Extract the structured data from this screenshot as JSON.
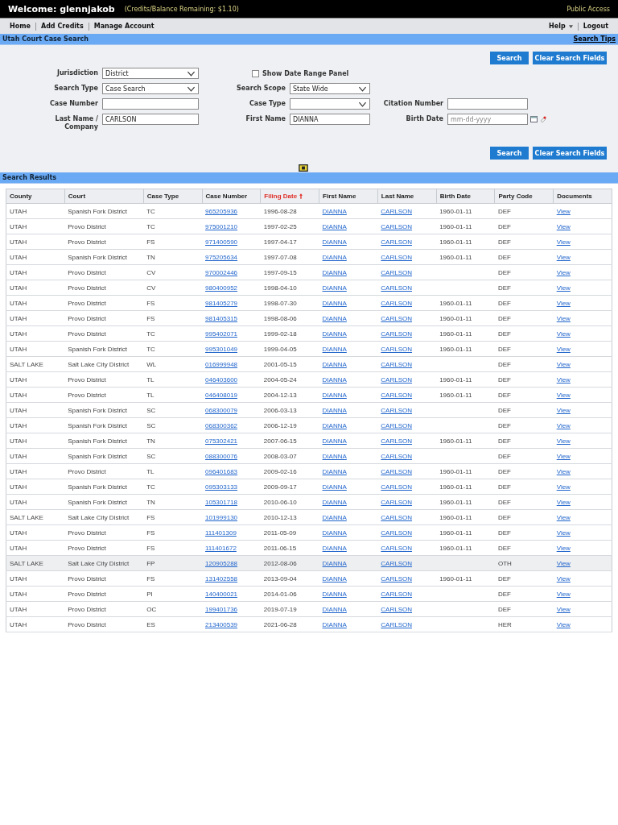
{
  "header": {
    "welcome": "Welcome: glennjakob",
    "credits": "(Credits/Balance Remaining: $1.10)",
    "access": "Public Access"
  },
  "nav": {
    "left": [
      "Home",
      "Add Credits",
      "Manage Account"
    ],
    "help": "Help",
    "logout": "Logout"
  },
  "search_panel": {
    "title": "Utah Court Case Search",
    "tips": "Search Tips",
    "top_buttons": {
      "search": "Search",
      "clear": "Clear Search Fields"
    },
    "bottom_buttons": {
      "search": "Search",
      "clear": "Clear Search Fields"
    },
    "jurisdiction": {
      "label": "Jurisdiction",
      "value": "District"
    },
    "date_range": {
      "label": "Show Date Range Panel",
      "checked": false
    },
    "search_type": {
      "label": "Search Type",
      "value": "Case Search"
    },
    "search_scope": {
      "label": "Search Scope",
      "value": "State Wide"
    },
    "case_number": {
      "label": "Case Number"
    },
    "case_type": {
      "label": "Case Type"
    },
    "citation_number": {
      "label": "Citation Number"
    },
    "last_name": {
      "label": "Last Name / Company",
      "value": "CARLSON"
    },
    "first_name": {
      "label": "First Name",
      "value": "DIANNA"
    },
    "birth_date": {
      "label": "Birth Date",
      "placeholder": "mm-dd-yyyy"
    }
  },
  "results": {
    "title": "Search Results",
    "columns": [
      {
        "label": "County",
        "sorted": false
      },
      {
        "label": "Court",
        "sorted": false
      },
      {
        "label": "Case Type",
        "sorted": false
      },
      {
        "label": "Case Number",
        "sorted": false
      },
      {
        "label": "Filing Date",
        "sorted": true
      },
      {
        "label": "First Name",
        "sorted": false
      },
      {
        "label": "Last Name",
        "sorted": false
      },
      {
        "label": "Birth Date",
        "sorted": false
      },
      {
        "label": "Party Code",
        "sorted": false
      },
      {
        "label": "Documents",
        "sorted": false
      }
    ],
    "rows": [
      {
        "county": "UTAH",
        "court": "Spanish Fork District",
        "case_type": "TC",
        "case_number": "965205936",
        "filing_date": "1996-08-28",
        "first_name": "DIANNA",
        "last_name": "CARLSON",
        "birth_date": "1960-01-11",
        "party_code": "DEF",
        "documents": "View",
        "selected": false
      },
      {
        "county": "UTAH",
        "court": "Provo District",
        "case_type": "TC",
        "case_number": "975001210",
        "filing_date": "1997-02-25",
        "first_name": "DIANNA",
        "last_name": "CARLSON",
        "birth_date": "1960-01-11",
        "party_code": "DEF",
        "documents": "View",
        "selected": false
      },
      {
        "county": "UTAH",
        "court": "Provo District",
        "case_type": "FS",
        "case_number": "971400590",
        "filing_date": "1997-04-17",
        "first_name": "DIANNA",
        "last_name": "CARLSON",
        "birth_date": "1960-01-11",
        "party_code": "DEF",
        "documents": "View",
        "selected": false
      },
      {
        "county": "UTAH",
        "court": "Spanish Fork District",
        "case_type": "TN",
        "case_number": "975205634",
        "filing_date": "1997-07-08",
        "first_name": "DIANNA",
        "last_name": "CARLSON",
        "birth_date": "1960-01-11",
        "party_code": "DEF",
        "documents": "View",
        "selected": false
      },
      {
        "county": "UTAH",
        "court": "Provo District",
        "case_type": "CV",
        "case_number": "970002446",
        "filing_date": "1997-09-15",
        "first_name": "DIANNA",
        "last_name": "CARLSON",
        "party_code": "DEF",
        "documents": "View",
        "selected": false
      },
      {
        "county": "UTAH",
        "court": "Provo District",
        "case_type": "CV",
        "case_number": "980400952",
        "filing_date": "1998-04-10",
        "first_name": "DIANNA",
        "last_name": "CARLSON",
        "party_code": "DEF",
        "documents": "View",
        "selected": false
      },
      {
        "county": "UTAH",
        "court": "Provo District",
        "case_type": "FS",
        "case_number": "981405279",
        "filing_date": "1998-07-30",
        "first_name": "DIANNA",
        "last_name": "CARLSON",
        "birth_date": "1960-01-11",
        "party_code": "DEF",
        "documents": "View",
        "selected": false
      },
      {
        "county": "UTAH",
        "court": "Provo District",
        "case_type": "FS",
        "case_number": "981405315",
        "filing_date": "1998-08-06",
        "first_name": "DIANNA",
        "last_name": "CARLSON",
        "birth_date": "1960-01-11",
        "party_code": "DEF",
        "documents": "View",
        "selected": false
      },
      {
        "county": "UTAH",
        "court": "Provo District",
        "case_type": "TC",
        "case_number": "995402071",
        "filing_date": "1999-02-18",
        "first_name": "DIANNA",
        "last_name": "CARLSON",
        "birth_date": "1960-01-11",
        "party_code": "DEF",
        "documents": "View",
        "selected": false
      },
      {
        "county": "UTAH",
        "court": "Spanish Fork District",
        "case_type": "TC",
        "case_number": "995301049",
        "filing_date": "1999-04-05",
        "first_name": "DIANNA",
        "last_name": "CARLSON",
        "birth_date": "1960-01-11",
        "party_code": "DEF",
        "documents": "View",
        "selected": false
      },
      {
        "county": "SALT LAKE",
        "court": "Salt Lake City District",
        "case_type": "WL",
        "case_number": "016999948",
        "filing_date": "2001-05-15",
        "first_name": "DIANNA",
        "last_name": "CARLSON",
        "party_code": "DEF",
        "documents": "View",
        "selected": false
      },
      {
        "county": "UTAH",
        "court": "Provo District",
        "case_type": "TL",
        "case_number": "046403600",
        "filing_date": "2004-05-24",
        "first_name": "DIANNA",
        "last_name": "CARLSON",
        "birth_date": "1960-01-11",
        "party_code": "DEF",
        "documents": "View",
        "selected": false
      },
      {
        "county": "UTAH",
        "court": "Provo District",
        "case_type": "TL",
        "case_number": "046408019",
        "filing_date": "2004-12-13",
        "first_name": "DIANNA",
        "last_name": "CARLSON",
        "birth_date": "1960-01-11",
        "party_code": "DEF",
        "documents": "View",
        "selected": false
      },
      {
        "county": "UTAH",
        "court": "Spanish Fork District",
        "case_type": "SC",
        "case_number": "068300079",
        "filing_date": "2006-03-13",
        "first_name": "DIANNA",
        "last_name": "CARLSON",
        "party_code": "DEF",
        "documents": "View",
        "selected": false
      },
      {
        "county": "UTAH",
        "court": "Spanish Fork District",
        "case_type": "SC",
        "case_number": "068300362",
        "filing_date": "2006-12-19",
        "first_name": "DIANNA",
        "last_name": "CARLSON",
        "party_code": "DEF",
        "documents": "View",
        "selected": false
      },
      {
        "county": "UTAH",
        "court": "Spanish Fork District",
        "case_type": "TN",
        "case_number": "075302421",
        "filing_date": "2007-06-15",
        "first_name": "DIANNA",
        "last_name": "CARLSON",
        "birth_date": "1960-01-11",
        "party_code": "DEF",
        "documents": "View",
        "selected": false
      },
      {
        "county": "UTAH",
        "court": "Spanish Fork District",
        "case_type": "SC",
        "case_number": "088300076",
        "filing_date": "2008-03-07",
        "first_name": "DIANNA",
        "last_name": "CARLSON",
        "party_code": "DEF",
        "documents": "View",
        "selected": false
      },
      {
        "county": "UTAH",
        "court": "Provo District",
        "case_type": "TL",
        "case_number": "096401683",
        "filing_date": "2009-02-16",
        "first_name": "DIANNA",
        "last_name": "CARLSON",
        "birth_date": "1960-01-11",
        "party_code": "DEF",
        "documents": "View",
        "selected": false
      },
      {
        "county": "UTAH",
        "court": "Spanish Fork District",
        "case_type": "TC",
        "case_number": "095303133",
        "filing_date": "2009-09-17",
        "first_name": "DIANNA",
        "last_name": "CARLSON",
        "birth_date": "1960-01-11",
        "party_code": "DEF",
        "documents": "View",
        "selected": false
      },
      {
        "county": "UTAH",
        "court": "Spanish Fork District",
        "case_type": "TN",
        "case_number": "105301718",
        "filing_date": "2010-06-10",
        "first_name": "DIANNA",
        "last_name": "CARLSON",
        "birth_date": "1960-01-11",
        "party_code": "DEF",
        "documents": "View",
        "selected": false
      },
      {
        "county": "SALT LAKE",
        "court": "Salt Lake City District",
        "case_type": "FS",
        "case_number": "101999130",
        "filing_date": "2010-12-13",
        "first_name": "DIANNA",
        "last_name": "CARLSON",
        "birth_date": "1960-01-11",
        "party_code": "DEF",
        "documents": "View",
        "selected": false
      },
      {
        "county": "UTAH",
        "court": "Provo District",
        "case_type": "FS",
        "case_number": "111401309",
        "filing_date": "2011-05-09",
        "first_name": "DIANNA",
        "last_name": "CARLSON",
        "birth_date": "1960-01-11",
        "party_code": "DEF",
        "documents": "View",
        "selected": false
      },
      {
        "county": "UTAH",
        "court": "Provo District",
        "case_type": "FS",
        "case_number": "111401672",
        "filing_date": "2011-06-15",
        "first_name": "DIANNA",
        "last_name": "CARLSON",
        "birth_date": "1960-01-11",
        "party_code": "DEF",
        "documents": "View",
        "selected": false
      },
      {
        "county": "SALT LAKE",
        "court": "Salt Lake City District",
        "case_type": "FP",
        "case_number": "120905288",
        "filing_date": "2012-08-06",
        "first_name": "DIANNA",
        "last_name": "CARLSON",
        "party_code": "OTH",
        "documents": "View",
        "selected": true
      },
      {
        "county": "UTAH",
        "court": "Provo District",
        "case_type": "FS",
        "case_number": "131402558",
        "filing_date": "2013-09-04",
        "first_name": "DIANNA",
        "last_name": "CARLSON",
        "birth_date": "1960-01-11",
        "party_code": "DEF",
        "documents": "View",
        "selected": false
      },
      {
        "county": "UTAH",
        "court": "Provo District",
        "case_type": "PI",
        "case_number": "140400021",
        "filing_date": "2014-01-06",
        "first_name": "DIANNA",
        "last_name": "CARLSON",
        "party_code": "DEF",
        "documents": "View",
        "selected": false
      },
      {
        "county": "UTAH",
        "court": "Provo District",
        "case_type": "OC",
        "case_number": "199401736",
        "filing_date": "2019-07-19",
        "first_name": "DIANNA",
        "last_name": "CARLSON",
        "party_code": "DEF",
        "documents": "View",
        "selected": false
      },
      {
        "county": "UTAH",
        "court": "Provo District",
        "case_type": "ES",
        "case_number": "213400539",
        "filing_date": "2021-06-28",
        "first_name": "DIANNA",
        "last_name": "CARLSON",
        "party_code": "HER",
        "documents": "View",
        "selected": false
      }
    ]
  }
}
